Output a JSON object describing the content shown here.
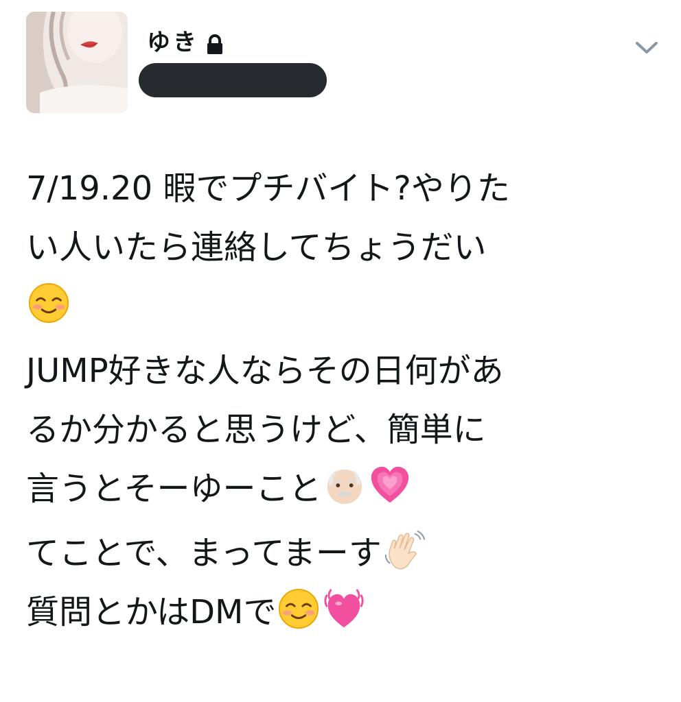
{
  "user": {
    "display_name": "ゆき",
    "protected_icon": "lock-icon",
    "handle_redacted": true
  },
  "menu": {
    "caret_icon": "chevron-down-icon"
  },
  "tweet": {
    "line1": "7/19.20 暇でプチバイト?やりた",
    "line2": "い人いたら連絡してちょうだい",
    "line4": "JUMP好きな人ならその日何があ",
    "line5": "るか分かると思うけど、簡単に",
    "line6": "言うとそーゆーこと",
    "line7": "てことで、まってまーす",
    "line8": "質問とかはDMで"
  },
  "emoji_names": {
    "smile": "smiling-face-icon",
    "old_man": "old-man-face-icon",
    "heart": "growing-heart-icon",
    "wave": "waving-hand-icon",
    "beating_heart": "beating-heart-icon"
  },
  "colors": {
    "text": "#14171a",
    "redaction": "#272b30",
    "caret": "#8899a6",
    "heart": "#f34fa0"
  }
}
